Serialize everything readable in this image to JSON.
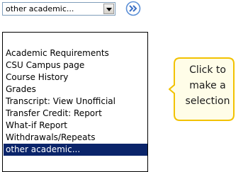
{
  "select": {
    "value": "other academic..."
  },
  "go_button": {
    "icon": "double-chevron-right-icon",
    "color": "#5b8fd6"
  },
  "dropdown": {
    "items": [
      {
        "label": ""
      },
      {
        "label": "Academic Requirements"
      },
      {
        "label": "CSU Campus page"
      },
      {
        "label": "Course History"
      },
      {
        "label": "Grades"
      },
      {
        "label": "Transcript: View Unofficial"
      },
      {
        "label": "Transfer Credit: Report"
      },
      {
        "label": "What-if Report"
      },
      {
        "label": "Withdrawals/Repeats"
      },
      {
        "label": "other academic..."
      }
    ],
    "selected_index": 9,
    "selected_color": "#0a246a"
  },
  "callout": {
    "lines": [
      "Click to",
      "make a",
      "selection"
    ],
    "fill": "#fffde8",
    "border_color": "#f2c200"
  }
}
